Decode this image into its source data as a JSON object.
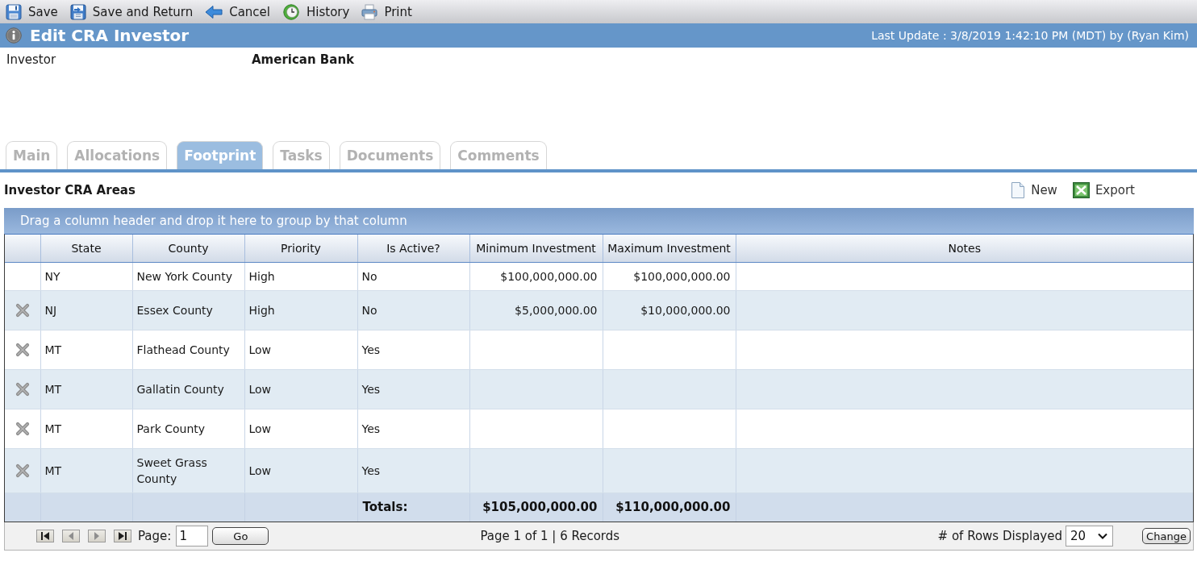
{
  "toolbar": [
    {
      "kind": "save",
      "label": "Save"
    },
    {
      "kind": "save_return",
      "label": "Save and Return"
    },
    {
      "kind": "cancel",
      "label": "Cancel"
    },
    {
      "kind": "history",
      "label": "History"
    },
    {
      "kind": "print",
      "label": "Print"
    }
  ],
  "title_bar": {
    "title": "Edit CRA Investor",
    "last_update": "Last Update : 3/8/2019 1:42:10 PM (MDT) by (Ryan Kim)"
  },
  "fields": [
    {
      "label": "Investor",
      "value": "American Bank"
    }
  ],
  "tabs": [
    {
      "label": "Main",
      "selected": false
    },
    {
      "label": "Allocations",
      "selected": false
    },
    {
      "label": "Footprint",
      "selected": true
    },
    {
      "label": "Tasks",
      "selected": false
    },
    {
      "label": "Documents",
      "selected": false
    },
    {
      "label": "Comments",
      "selected": false
    }
  ],
  "section": {
    "title": "Investor CRA Areas",
    "actions": [
      {
        "kind": "new",
        "label": "New"
      },
      {
        "kind": "export",
        "label": "Export"
      }
    ]
  },
  "grid": {
    "group_hint": "Drag a column header and drop it here to group by that column",
    "columns": [
      {
        "label": "State",
        "kind": "text"
      },
      {
        "label": "County",
        "kind": "text"
      },
      {
        "label": "Priority",
        "kind": "text"
      },
      {
        "label": "Is Active?",
        "kind": "text"
      },
      {
        "label": "Minimum Investment",
        "kind": "money"
      },
      {
        "label": "Maximum Investment",
        "kind": "money"
      },
      {
        "label": "Notes",
        "kind": "text"
      }
    ],
    "rows": [
      {
        "deletable": false,
        "cells": [
          "NY",
          "New York County",
          "High",
          "No",
          "$100,000,000.00",
          "$100,000,000.00"
        ]
      },
      {
        "deletable": true,
        "cells": [
          "NJ",
          "Essex County",
          "High",
          "No",
          "$5,000,000.00",
          "$10,000,000.00"
        ]
      },
      {
        "deletable": true,
        "cells": [
          "MT",
          "Flathead County",
          "Low",
          "Yes"
        ]
      },
      {
        "deletable": true,
        "cells": [
          "MT",
          "Gallatin County",
          "Low",
          "Yes"
        ]
      },
      {
        "deletable": true,
        "cells": [
          "MT",
          "Park County",
          "Low",
          "Yes"
        ]
      },
      {
        "deletable": true,
        "cells": [
          "MT",
          "Sweet Grass County",
          "Low",
          "Yes"
        ]
      }
    ],
    "totals": {
      "label": "Totals:",
      "values": [
        "$105,000,000.00",
        "$110,000,000.00"
      ]
    }
  },
  "pager": {
    "page_label": "Page:",
    "page_value": "1",
    "go": "Go",
    "summary": "Page 1 of 1 | 6 Records",
    "rows_label": "# of Rows Displayed",
    "rows_value": "20",
    "change": "Change"
  }
}
